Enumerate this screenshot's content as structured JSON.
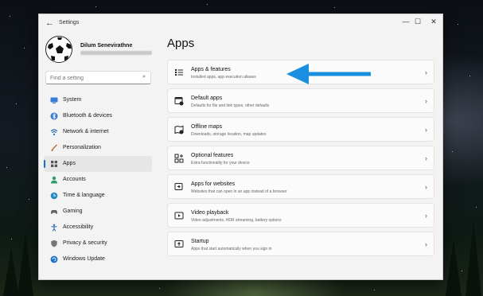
{
  "window": {
    "title": "Settings",
    "controls": {
      "minimize": "—",
      "maximize": "☐",
      "close": "✕"
    }
  },
  "profile": {
    "name": "Dilum Senevirathne"
  },
  "search": {
    "placeholder": "Find a setting"
  },
  "nav": {
    "items": [
      {
        "label": "System",
        "icon": "monitor-icon",
        "color": "#3a7bd5"
      },
      {
        "label": "Bluetooth & devices",
        "icon": "bluetooth-icon",
        "color": "#3a7bd5"
      },
      {
        "label": "Network & internet",
        "icon": "wifi-icon",
        "color": "#2b6cb0"
      },
      {
        "label": "Personalization",
        "icon": "brush-icon",
        "color": "#b26b3a"
      },
      {
        "label": "Apps",
        "icon": "apps-icon",
        "color": "#555555"
      },
      {
        "label": "Accounts",
        "icon": "person-icon",
        "color": "#2e9b6a"
      },
      {
        "label": "Time & language",
        "icon": "globe-clock-icon",
        "color": "#2b8cc4"
      },
      {
        "label": "Gaming",
        "icon": "controller-icon",
        "color": "#666666"
      },
      {
        "label": "Accessibility",
        "icon": "accessibility-icon",
        "color": "#2b6cb0"
      },
      {
        "label": "Privacy & security",
        "icon": "shield-icon",
        "color": "#666666"
      },
      {
        "label": "Windows Update",
        "icon": "update-icon",
        "color": "#1a6fc4"
      }
    ],
    "active_index": 4
  },
  "main": {
    "title": "Apps",
    "cards": [
      {
        "title": "Apps & features",
        "desc": "Installed apps, app execution aliases",
        "icon": "list-icon"
      },
      {
        "title": "Default apps",
        "desc": "Defaults for file and link types, other defaults",
        "icon": "default-apps-icon"
      },
      {
        "title": "Offline maps",
        "desc": "Downloads, storage location, map updates",
        "icon": "map-icon"
      },
      {
        "title": "Optional features",
        "desc": "Extra functionality for your device",
        "icon": "grid-plus-icon"
      },
      {
        "title": "Apps for websites",
        "desc": "Websites that can open in an app instead of a browser",
        "icon": "link-app-icon"
      },
      {
        "title": "Video playback",
        "desc": "Video adjustments, HDR streaming, battery options",
        "icon": "video-icon"
      },
      {
        "title": "Startup",
        "desc": "Apps that start automatically when you sign in",
        "icon": "startup-icon"
      }
    ]
  },
  "annotation": {
    "arrow_color": "#1a8fe0"
  },
  "colors": {
    "accent": "#1a6fc4"
  }
}
